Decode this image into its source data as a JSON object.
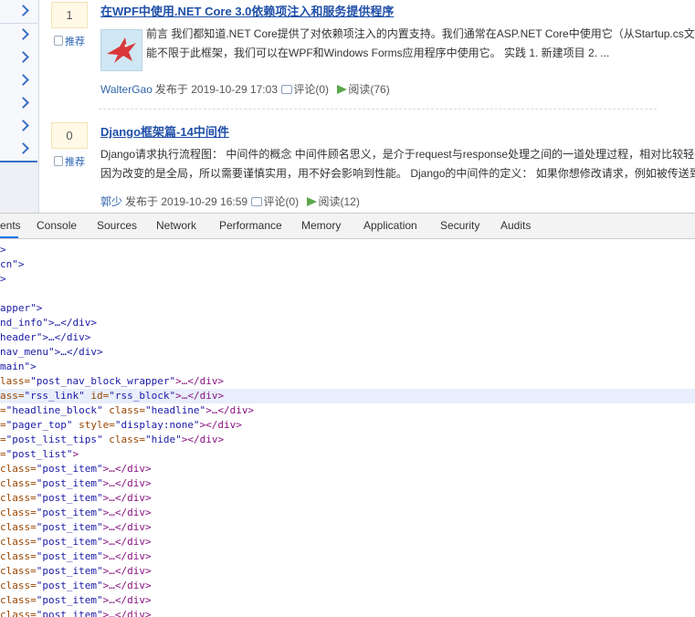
{
  "blog": {
    "posts": [
      {
        "votes": "1",
        "recommend": "推荐",
        "title": "在WPF中使用.NET Core 3.0依赖项注入和服务提供程序",
        "summary_line1": "前言 我们都知道.NET Core提供了对依赖项注入的内置支持。我们通常在ASP.NET Core中使用它（从Startup.cs文",
        "summary_line2": "能不限于此框架，我们可以在WPF和Windows Forms应用程序中使用它。 实践 1. 新建项目 2. ...",
        "author": "WalterGao",
        "posted": "发布于 2019-10-29 17:03",
        "comments": "评论(0)",
        "reads": "阅读(76)",
        "has_image": true
      },
      {
        "votes": "0",
        "recommend": "推荐",
        "title": "Django框架篇-14中间件",
        "summary_line1": "Django请求执行流程图： 中间件的概念 中间件顾名思义，是介于request与response处理之间的一道处理过程，相对比较轻",
        "summary_line2": "因为改变的是全局，所以需要谨慎实用，用不好会影响到性能。 Django的中间件的定义： 如果你想修改请求，例如被传送到",
        "author": "郭少",
        "posted": "发布于 2019-10-29 16:59",
        "comments": "评论(0)",
        "reads": "阅读(12)",
        "has_image": false
      }
    ]
  },
  "devtools": {
    "tabs": [
      "ents",
      "Console",
      "Sources",
      "Network",
      "Performance",
      "Memory",
      "Application",
      "Security",
      "Audits"
    ],
    "active_tab": "ents",
    "lines": [
      {
        "pre": ">",
        "tag": "",
        "attrs": [],
        "post": ""
      },
      {
        "pre": "cn\">",
        "tag": "",
        "attrs": [],
        "post": ""
      },
      {
        "pre": ">",
        "tag": "",
        "attrs": [],
        "post": ""
      },
      {
        "pre": "",
        "tag": "",
        "attrs": [],
        "post": ""
      },
      {
        "pre": "apper\">",
        "tag": "",
        "attrs": [],
        "post": ""
      },
      {
        "pre": "nd_info\">…</div>",
        "tag": "",
        "attrs": [],
        "post": ""
      },
      {
        "pre": "header\">…</div>",
        "tag": "",
        "attrs": [],
        "post": ""
      },
      {
        "pre": "nav_menu\">…</div>",
        "tag": "",
        "attrs": [],
        "post": ""
      },
      {
        "pre": "main\">",
        "tag": "",
        "attrs": [],
        "post": ""
      },
      {
        "pre": "lass=",
        "val": "\"post_nav_block_wrapper\"",
        "post": ">…</div>"
      },
      {
        "pre": "ass=",
        "val": "\"rss_link\"",
        "mid": " id=",
        "val2": "\"rss_block\"",
        "post": ">…</div>",
        "selected": true
      },
      {
        "pre": "=",
        "val": "\"headline_block\"",
        "mid": " class=",
        "val2": "\"headline\"",
        "post": ">…</div>"
      },
      {
        "pre": "=",
        "val": "\"pager_top\"",
        "mid": " style=",
        "val2": "\"display:none\"",
        "post": "></div>"
      },
      {
        "pre": "=",
        "val": "\"post_list_tips\"",
        "mid": " class=",
        "val2": "\"hide\"",
        "post": "></div>"
      },
      {
        "pre": "=",
        "val": "\"post_list\"",
        "post": ">"
      },
      {
        "pre": "class=",
        "val": "\"post_item\"",
        "post": ">…</div>"
      },
      {
        "pre": "class=",
        "val": "\"post_item\"",
        "post": ">…</div>"
      },
      {
        "pre": "class=",
        "val": "\"post_item\"",
        "post": ">…</div>"
      },
      {
        "pre": "class=",
        "val": "\"post_item\"",
        "post": ">…</div>"
      },
      {
        "pre": "class=",
        "val": "\"post_item\"",
        "post": ">…</div>"
      },
      {
        "pre": "class=",
        "val": "\"post_item\"",
        "post": ">…</div>"
      },
      {
        "pre": "class=",
        "val": "\"post_item\"",
        "post": ">…</div>"
      },
      {
        "pre": "class=",
        "val": "\"post_item\"",
        "post": ">…</div>"
      },
      {
        "pre": "class=",
        "val": "\"post_item\"",
        "post": ">…</div>"
      },
      {
        "pre": "class=",
        "val": "\"post_item\"",
        "post": ">…</div>"
      },
      {
        "pre": "class=",
        "val": "\"post item\"",
        "post": ">…</div>"
      }
    ]
  },
  "colors": {
    "link_blue": "#1f4fa8",
    "tab_accent": "#1a73e8",
    "selected_row": "#e8eefb",
    "read_arrow": "#5aa84a"
  }
}
